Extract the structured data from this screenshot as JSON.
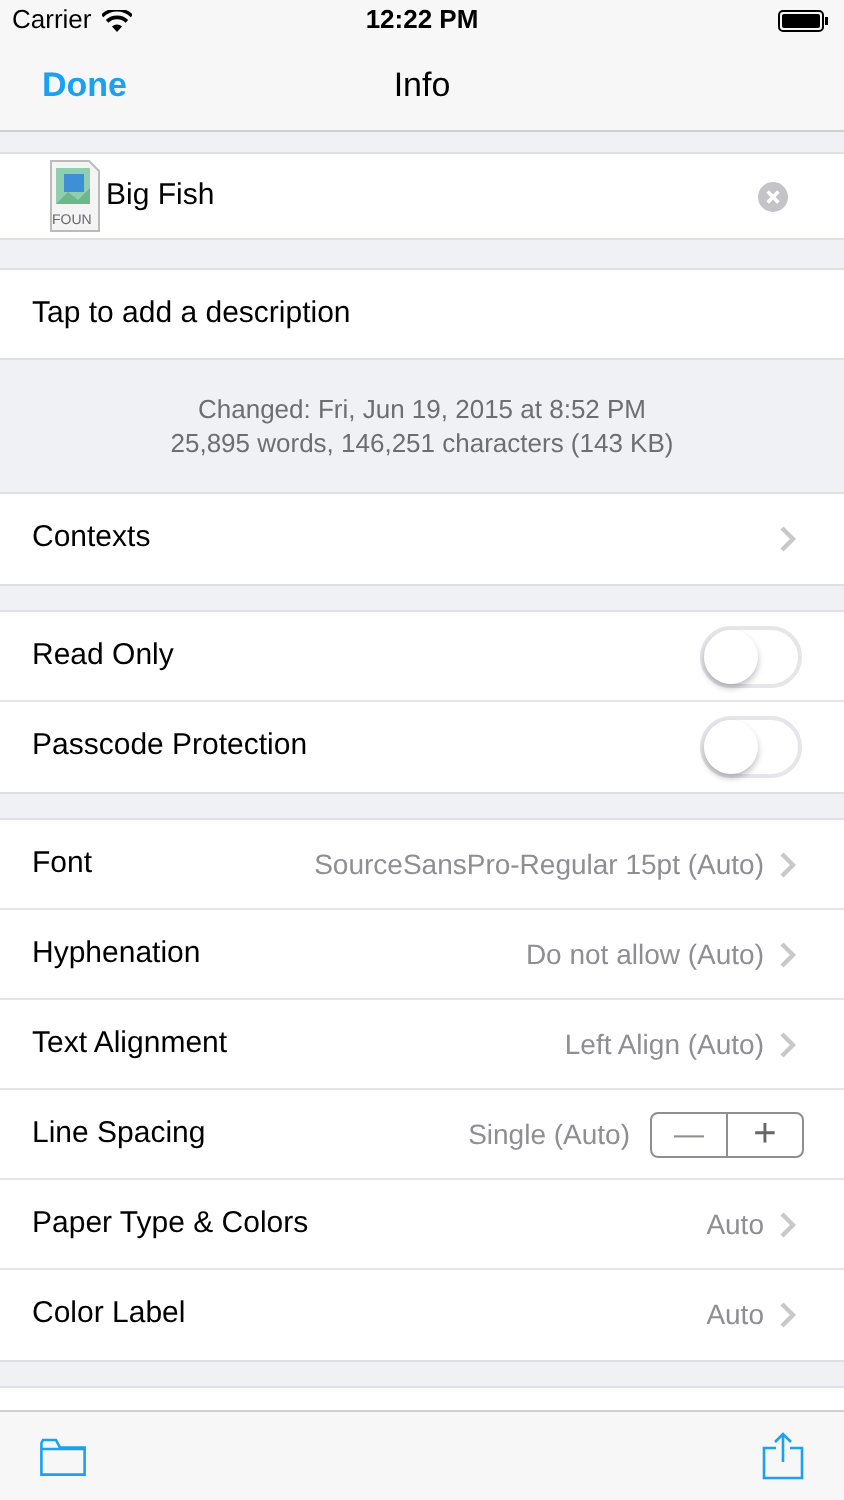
{
  "status_bar": {
    "carrier": "Carrier",
    "time": "12:22 PM"
  },
  "nav": {
    "done": "Done",
    "title": "Info"
  },
  "document": {
    "name": "Big Fish",
    "icon_label": "FOUN"
  },
  "description": {
    "placeholder": "Tap to add a description"
  },
  "stats": {
    "changed": "Changed: Fri, Jun 19, 2015 at 8:52 PM",
    "counts": "25,895 words, 146,251 characters (143 KB)"
  },
  "sections": [
    [
      {
        "kind": "disclosure",
        "label": "Contexts"
      }
    ],
    [
      {
        "kind": "toggle",
        "label": "Read Only",
        "on": false
      },
      {
        "kind": "toggle",
        "label": "Passcode Protection",
        "on": false
      }
    ],
    [
      {
        "kind": "disclosure",
        "label": "Font",
        "value": "SourceSansPro-Regular 15pt (Auto)"
      },
      {
        "kind": "disclosure",
        "label": "Hyphenation",
        "value": "Do not allow (Auto)"
      },
      {
        "kind": "disclosure",
        "label": "Text Alignment",
        "value": "Left Align (Auto)"
      },
      {
        "kind": "stepper",
        "label": "Line Spacing",
        "value": "Single (Auto)",
        "minus": "—",
        "plus": "+"
      },
      {
        "kind": "disclosure",
        "label": "Paper Type & Colors",
        "value": "Auto"
      },
      {
        "kind": "disclosure",
        "label": "Color Label",
        "value": "Auto"
      }
    ]
  ]
}
